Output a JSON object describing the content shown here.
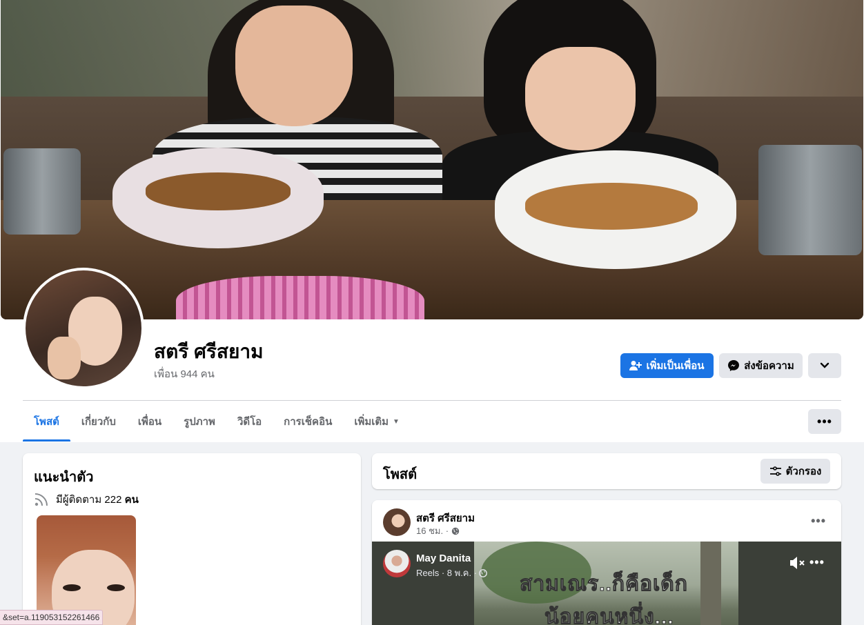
{
  "profile": {
    "name": "สตรี ศรีสยาม",
    "friends": "เพื่อน 944 คน"
  },
  "actions": {
    "add_friend": "เพิ่มเป็นเพื่อน",
    "message": "ส่งข้อความ"
  },
  "tabs": [
    {
      "label": "โพสต์",
      "active": true
    },
    {
      "label": "เกี่ยวกับ"
    },
    {
      "label": "เพื่อน"
    },
    {
      "label": "รูปภาพ"
    },
    {
      "label": "วิดีโอ"
    },
    {
      "label": "การเช็คอิน"
    },
    {
      "label": "เพิ่มเติม"
    }
  ],
  "intro": {
    "title": "แนะนำตัว",
    "followers_prefix": "มีผู้ติดตาม 222 ",
    "followers_unit": "คน"
  },
  "posts": {
    "title": "โพสต์",
    "filter_label": "ตัวกรอง"
  },
  "post": {
    "author": "สตรี ศรีสยาม",
    "time": "16 ชม. ·",
    "reel": {
      "author": "May Danita",
      "meta": "Reels · 8 พ.ค. ·",
      "overlay_line1": "สามเณร..ก็คือเด็ก",
      "overlay_line2": "น้อยคนหนึ่ง..."
    }
  },
  "status_bar": {
    "url": "&set=a.119053152261466"
  },
  "colors": {
    "accent": "#1b74e4",
    "background": "#f0f2f5",
    "secondary_button": "#e4e6eb"
  },
  "icons": [
    "add-friend-icon",
    "messenger-icon",
    "chevron-down-icon",
    "more-icon",
    "rss-icon",
    "filter-icon",
    "globe-icon",
    "mute-icon"
  ]
}
